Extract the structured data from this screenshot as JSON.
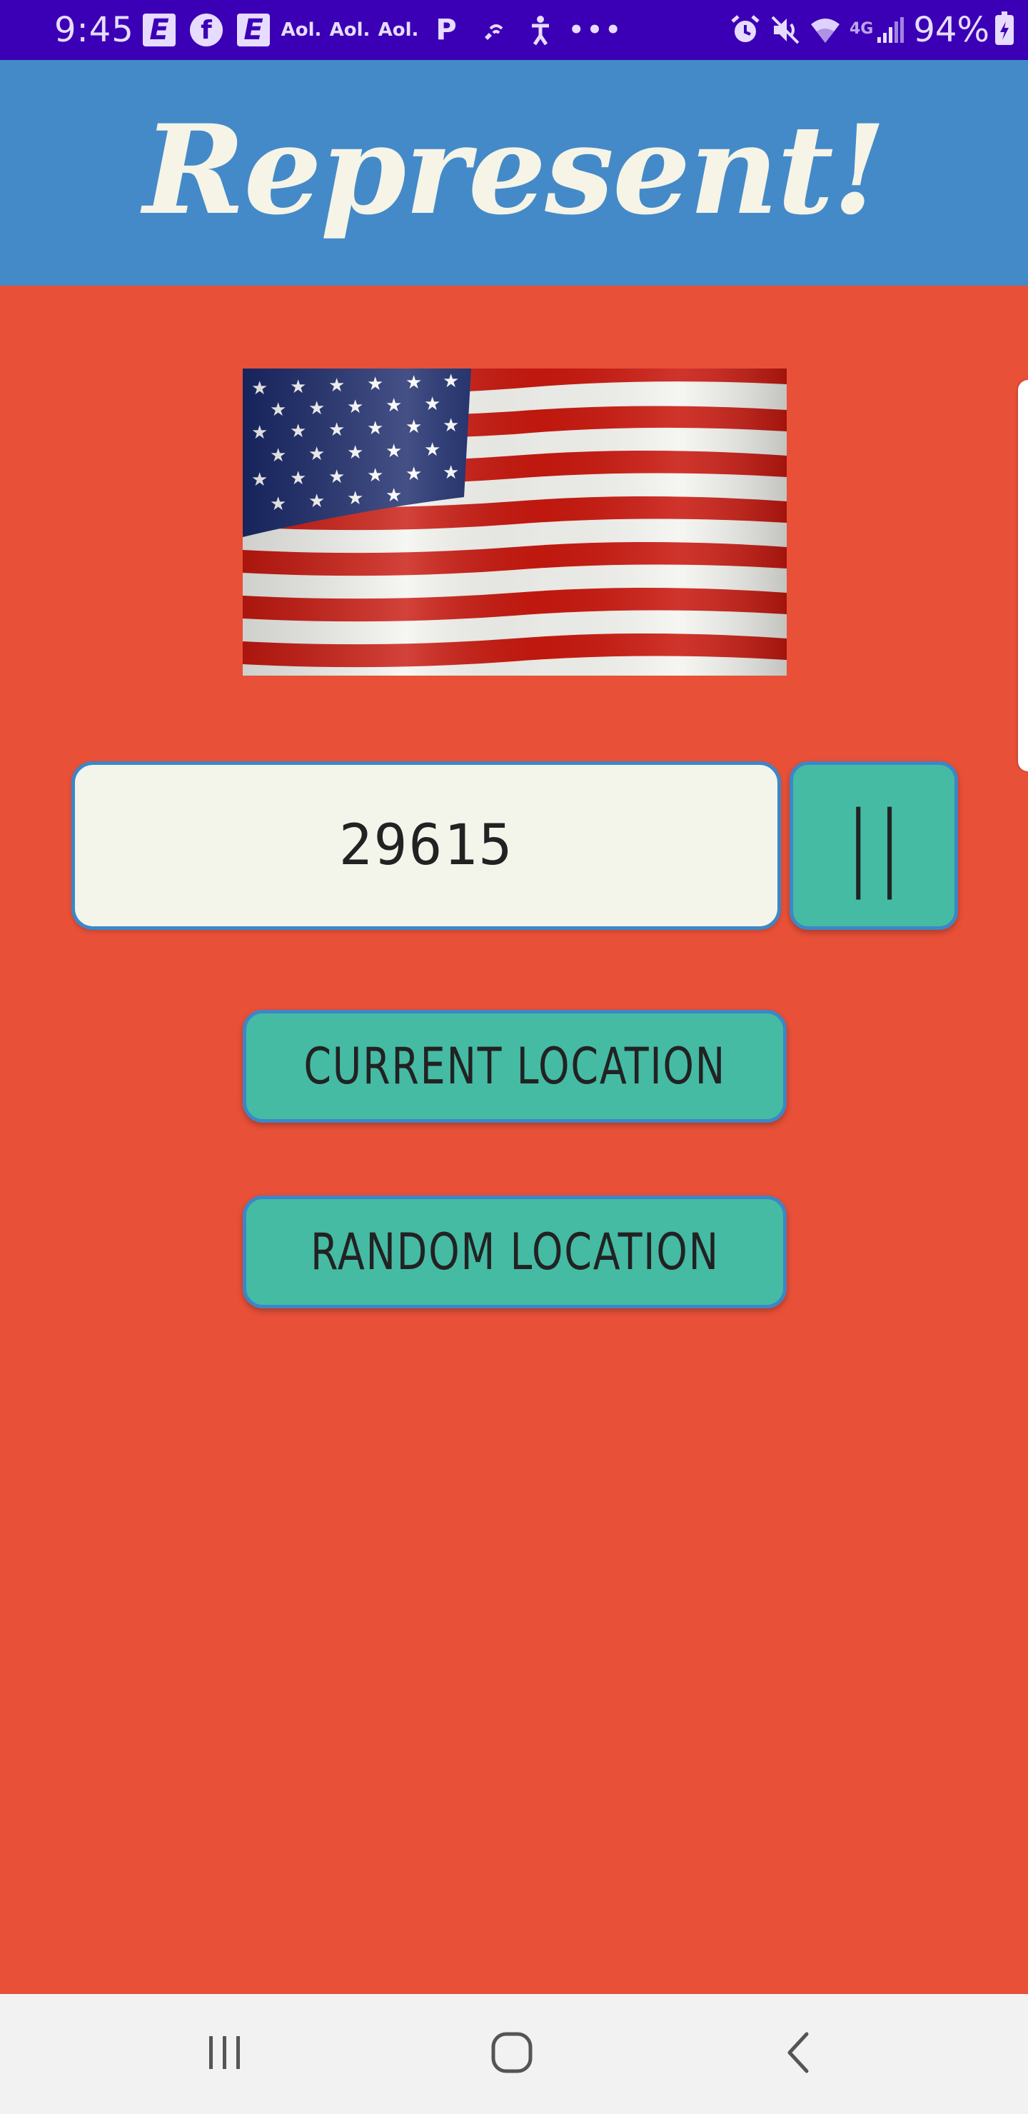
{
  "status_bar": {
    "time": "9:45",
    "aol_labels": [
      "Aol.",
      "Aol.",
      "Aol."
    ],
    "e_label": "E",
    "fb_label": "f",
    "p_label": "P",
    "dots_label": "•••",
    "network_label": "4G",
    "battery_percent": "94%",
    "icons": [
      "e-app-icon",
      "facebook-icon",
      "e-app-icon",
      "aol-icon",
      "aol-icon",
      "aol-icon",
      "p-icon",
      "wifi-call-icon",
      "accessibility-icon",
      "more-dots-icon",
      "alarm-icon",
      "mute-icon",
      "wifi-icon",
      "signal-icon",
      "battery-icon"
    ]
  },
  "header": {
    "title": "Represent!"
  },
  "search": {
    "zip_value": "29615",
    "go_label": "||"
  },
  "buttons": {
    "current_location": "CURRENT LOCATION",
    "random_location": "RANDOM LOCATION"
  },
  "nav": {
    "icons": [
      "recents-icon",
      "home-icon",
      "back-icon"
    ]
  },
  "colors": {
    "status_bar": "#3b00b5",
    "header": "#448ac8",
    "background": "#e85038",
    "button": "#45bba4",
    "border": "#3d86c7",
    "input": "#f3f5ea",
    "title": "#f5f4e7"
  }
}
